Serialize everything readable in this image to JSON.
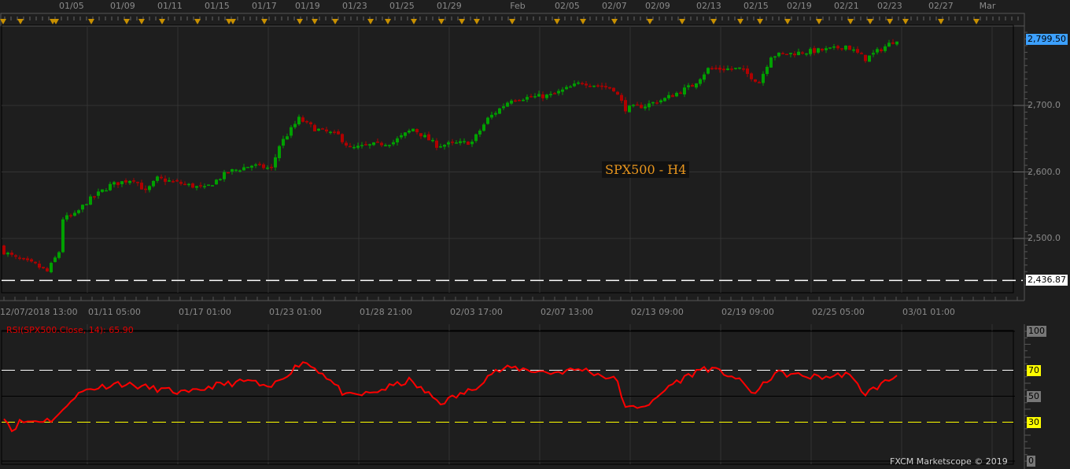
{
  "chart_data": [
    {
      "type": "candlestick",
      "title": "SPX500 - H4",
      "symbol": "SPX500",
      "timeframe": "H4",
      "ylim": [
        2420,
        2815
      ],
      "y_ticks": [
        "2,700.0",
        "2,600.0",
        "2,500.0"
      ],
      "y_tick_values": [
        2700,
        2600,
        2500
      ],
      "last_price": "2,799.50",
      "last_price_value": 2799.5,
      "low_line": "2,436.87",
      "low_line_value": 2436.87,
      "top_date_labels": [
        "01/05",
        "01/09",
        "01/11",
        "01/15",
        "01/17",
        "01/19",
        "01/23",
        "01/25",
        "01/29",
        "Feb",
        "02/05",
        "02/07",
        "02/09",
        "02/13",
        "02/15",
        "02/19",
        "02/21",
        "02/23",
        "02/27",
        "Mar"
      ],
      "bottom_time_labels": [
        "12/07/2018 13:00",
        "01/11 05:00",
        "01/17 01:00",
        "01/23 01:00",
        "01/28 21:00",
        "02/03 17:00",
        "02/07 13:00",
        "02/13 09:00",
        "02/19 09:00",
        "02/25 05:00",
        "03/01 01:00"
      ],
      "close_path_anchors": [
        [
          0,
          2480
        ],
        [
          3,
          2470
        ],
        [
          8,
          2460
        ],
        [
          11,
          2450
        ],
        [
          14,
          2480
        ],
        [
          15,
          2530
        ],
        [
          18,
          2535
        ],
        [
          21,
          2555
        ],
        [
          27,
          2580
        ],
        [
          33,
          2590
        ],
        [
          36,
          2570
        ],
        [
          39,
          2590
        ],
        [
          47,
          2580
        ],
        [
          51,
          2575
        ],
        [
          57,
          2600
        ],
        [
          63,
          2610
        ],
        [
          68,
          2605
        ],
        [
          70,
          2640
        ],
        [
          75,
          2680
        ],
        [
          79,
          2665
        ],
        [
          85,
          2655
        ],
        [
          88,
          2635
        ],
        [
          93,
          2640
        ],
        [
          99,
          2645
        ],
        [
          104,
          2665
        ],
        [
          110,
          2640
        ],
        [
          119,
          2645
        ],
        [
          123,
          2680
        ],
        [
          129,
          2710
        ],
        [
          139,
          2715
        ],
        [
          147,
          2735
        ],
        [
          155,
          2725
        ],
        [
          158,
          2695
        ],
        [
          163,
          2700
        ],
        [
          168,
          2710
        ],
        [
          175,
          2730
        ],
        [
          179,
          2755
        ],
        [
          187,
          2755
        ],
        [
          192,
          2735
        ],
        [
          195,
          2775
        ],
        [
          203,
          2780
        ],
        [
          211,
          2785
        ],
        [
          214,
          2790
        ],
        [
          219,
          2770
        ],
        [
          227,
          2800
        ]
      ],
      "colors": {
        "up": "#00a000",
        "down": "#b00000"
      }
    },
    {
      "type": "line",
      "title": "RSI(SPX500.Close, 14): 65.90",
      "ylim": [
        0,
        100
      ],
      "y_ticks": [
        "100",
        "70",
        "50",
        "30",
        "0"
      ],
      "levels": [
        70,
        50,
        30
      ],
      "rsi_path_anchors": [
        [
          0,
          35
        ],
        [
          2,
          24
        ],
        [
          4,
          30
        ],
        [
          12,
          32
        ],
        [
          15,
          38
        ],
        [
          17,
          48
        ],
        [
          21,
          55
        ],
        [
          29,
          60
        ],
        [
          47,
          52
        ],
        [
          53,
          58
        ],
        [
          63,
          62
        ],
        [
          67,
          55
        ],
        [
          76,
          77
        ],
        [
          81,
          68
        ],
        [
          87,
          50
        ],
        [
          93,
          52
        ],
        [
          103,
          62
        ],
        [
          111,
          45
        ],
        [
          119,
          55
        ],
        [
          124,
          68
        ],
        [
          129,
          72
        ],
        [
          139,
          68
        ],
        [
          147,
          71
        ],
        [
          156,
          62
        ],
        [
          158,
          40
        ],
        [
          165,
          45
        ],
        [
          169,
          58
        ],
        [
          178,
          72
        ],
        [
          185,
          66
        ],
        [
          191,
          52
        ],
        [
          196,
          68
        ],
        [
          205,
          65
        ],
        [
          211,
          65
        ],
        [
          214,
          68
        ],
        [
          219,
          52
        ],
        [
          227,
          66
        ]
      ],
      "color": "#ff0000"
    }
  ],
  "footer": {
    "copyright": "FXCM Marketscope © 2019"
  }
}
